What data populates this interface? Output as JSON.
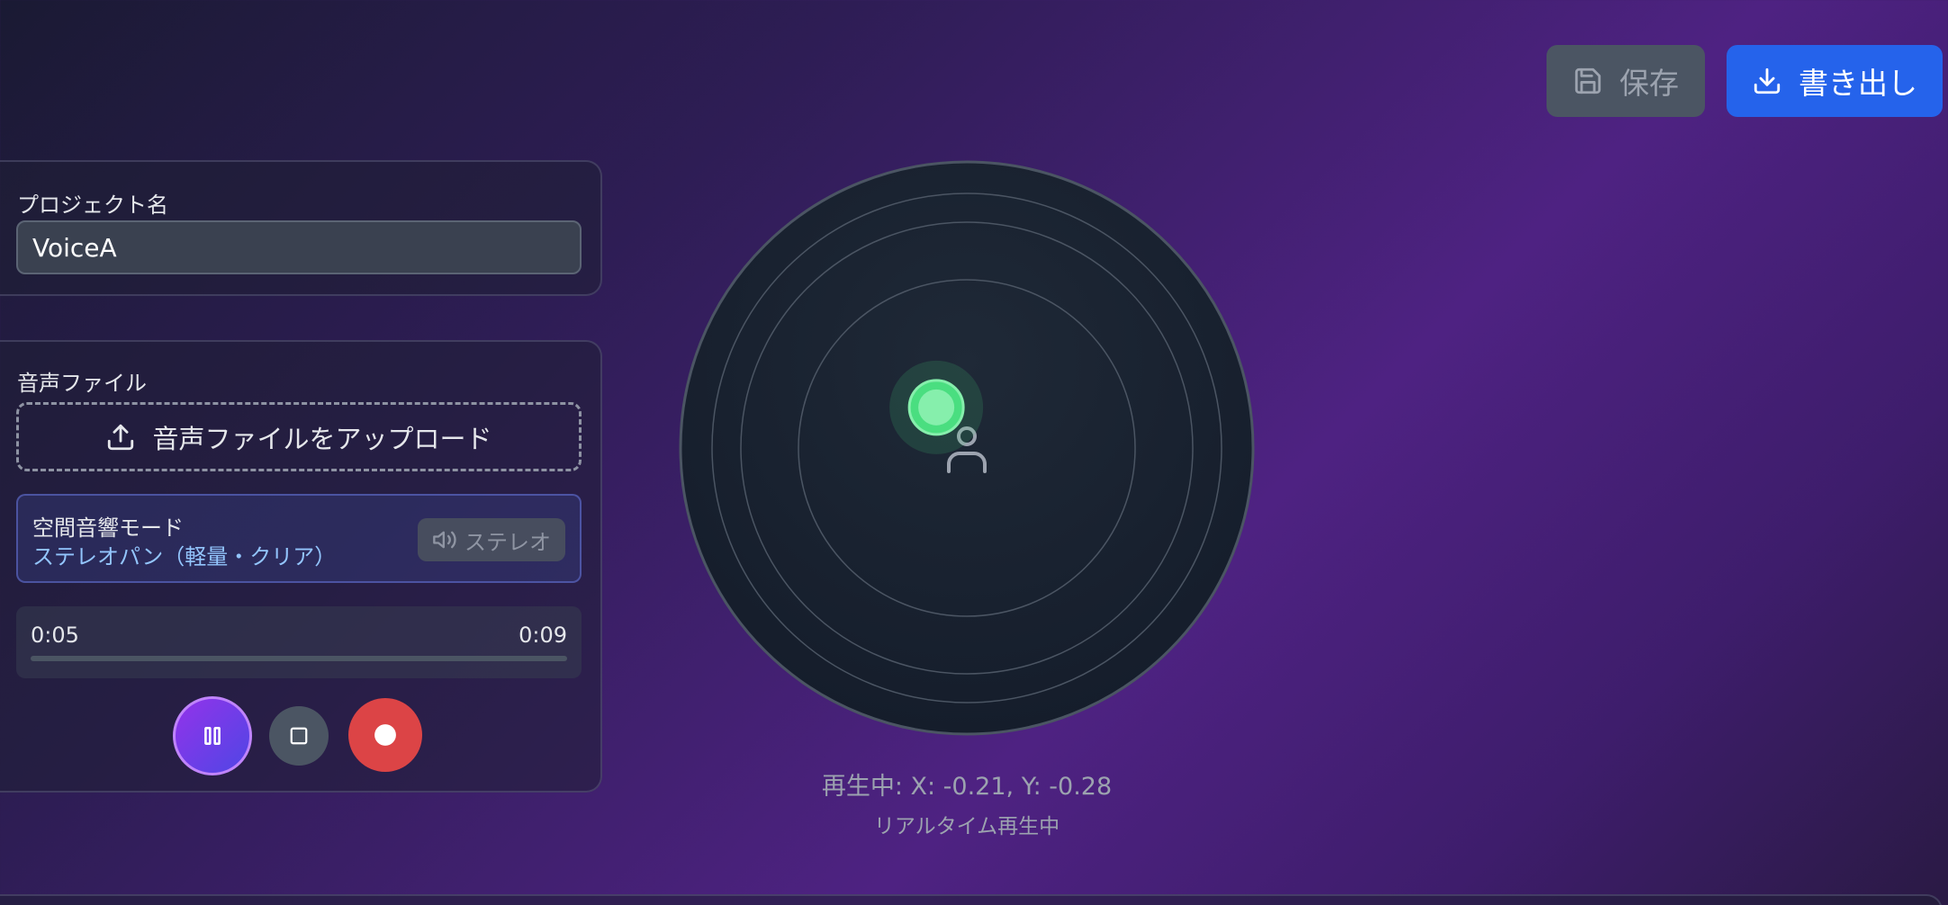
{
  "header": {
    "save_label": "保存",
    "export_label": "書き出し",
    "save_icon": "save-icon",
    "export_icon": "download-icon"
  },
  "project": {
    "label": "プロジェクト名",
    "name_value": "VoiceA"
  },
  "audio": {
    "label": "音声ファイル",
    "upload_label": "音声ファイルをアップロード",
    "upload_icon": "upload-icon",
    "spatial_mode": {
      "title": "空間音響モード",
      "description": "ステレオパン（軽量・クリア）",
      "toggle_label": "ステレオ",
      "toggle_icon": "speaker-icon"
    },
    "playback": {
      "current_time": "0:05",
      "total_time": "0:09",
      "progress_fraction": 0.0
    },
    "controls": {
      "pause_icon": "pause-icon",
      "stop_icon": "stop-icon",
      "record_icon": "record-icon"
    }
  },
  "spatial_pad": {
    "source_x": -0.21,
    "source_y": -0.28,
    "listener_icon": "person-icon",
    "source_color": "#4ade80"
  },
  "status": {
    "position_text": "再生中: X: -0.21, Y: -0.28",
    "state_text": "リアルタイム再生中"
  },
  "colors": {
    "accent": "#2563eb",
    "record": "#dc4446",
    "source": "#4ade80",
    "info_text": "#93c5fd"
  }
}
